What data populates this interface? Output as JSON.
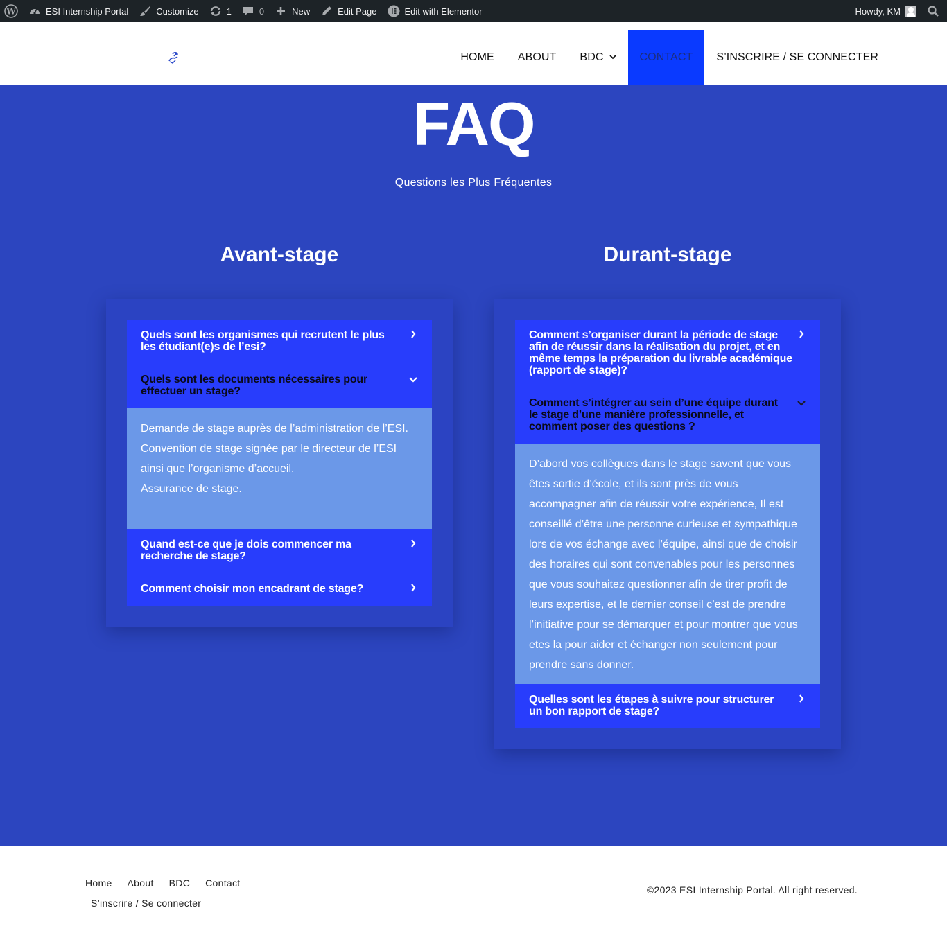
{
  "admin_bar": {
    "site_name": "ESI Internship Portal",
    "customize": "Customize",
    "updates_count": "1",
    "comments_count": "0",
    "new": "New",
    "edit_page": "Edit Page",
    "edit_elementor": "Edit with Elementor",
    "howdy": "Howdy, KM"
  },
  "nav": {
    "items": [
      {
        "label": "HOME"
      },
      {
        "label": "ABOUT"
      },
      {
        "label": "BDC"
      },
      {
        "label": "CONTACT"
      },
      {
        "label": "S’INSCRIRE / SE CONNECTER"
      }
    ],
    "active_color": "#0a3aff"
  },
  "hero": {
    "title": "FAQ",
    "subtitle": "Questions les Plus Fréquentes",
    "background": "#2c45bf"
  },
  "avant": {
    "heading": "Avant-stage",
    "items": [
      {
        "question": "Quels sont les organismes qui recrutent le plus les étudiant(e)s de l’esi?",
        "icon": "chevron-right-icon"
      },
      {
        "question": "Quels sont les documents nécessaires pour effectuer un stage?",
        "icon": "chevron-down-icon",
        "answer_lines": [
          "Demande de stage auprès de l’administration de l’ESI.",
          "Convention de stage signée par le directeur de l’ESI ainsi que l’organisme d’accueil.",
          "Assurance de stage."
        ]
      },
      {
        "question": "Quand est-ce que je dois commencer ma recherche de stage?",
        "icon": "chevron-right-icon"
      },
      {
        "question": "Comment choisir mon encadrant de stage?",
        "icon": "chevron-right-icon"
      }
    ]
  },
  "durant": {
    "heading": "Durant-stage",
    "items": [
      {
        "question": "Comment s’organiser durant la période de stage afin de réussir dans la réalisation du projet, et en même temps la préparation du livrable académique (rapport de stage)?",
        "icon": "chevron-right-icon"
      },
      {
        "question": "Comment s’intégrer au sein d’une équipe durant le stage d’une manière professionnelle, et comment poser des questions ?",
        "icon": "chevron-down-icon",
        "answer": "D’abord vos collègues dans le stage savent que vous êtes sortie d’école, et ils sont près de vous accompagner afin de réussir votre expérience, Il est conseillé d’être une personne curieuse et sympathique lors de vos échange avec l’équipe, ainsi que de choisir des horaires qui sont convenables pour les personnes que vous souhaitez questionner afin de tirer profit de leurs expertise, et le dernier conseil c’est de prendre l’initiative pour se démarquer et pour montrer que vous etes la pour aider et échanger non seulement pour prendre sans donner."
      },
      {
        "question": "Quelles sont les étapes à suivre pour structurer un bon rapport de stage?",
        "icon": "chevron-right-icon"
      }
    ]
  },
  "footer": {
    "menu": [
      {
        "label": "Home"
      },
      {
        "label": "About"
      },
      {
        "label": "BDC"
      },
      {
        "label": "Contact"
      },
      {
        "label": "S’inscrire / Se connecter"
      }
    ],
    "copyright": "©2023 ESI Internship Portal. All right reserved."
  }
}
